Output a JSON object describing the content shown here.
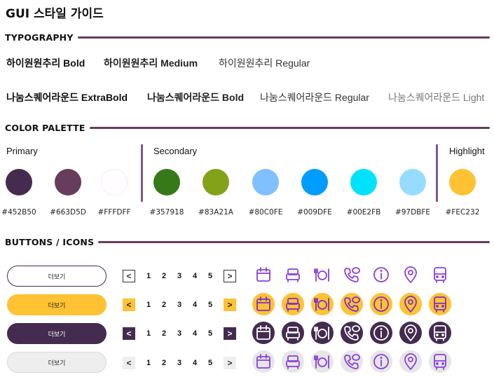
{
  "title": "GUI 스타일 가이드",
  "sections": {
    "typography": "TYPOGRAPHY",
    "color": "COLOR PALETTE",
    "buttons": "BUTTONS / ICONS"
  },
  "typography": {
    "row1": [
      "하이원원추리 Bold",
      "하이원원추리 Medium",
      "하이원원추리 Regular"
    ],
    "row2": [
      "나눔스퀘어라운드 ExtraBold",
      "나눔스퀘어라운드 Bold",
      "나눔스퀘어라운드 Regular",
      "나눔스퀘어라운드 Light"
    ]
  },
  "palette": {
    "primary_label": "Primary",
    "secondary_label": "Secondary",
    "highlight_label": "Highlight",
    "primary": [
      {
        "hex": "#452B50",
        "color": "#452B50"
      },
      {
        "hex": "#663D5D",
        "color": "#663D5D"
      },
      {
        "hex": "#FFFDFF",
        "color": "#FFFDFF"
      }
    ],
    "secondary": [
      {
        "hex": "#357918",
        "color": "#357918"
      },
      {
        "hex": "#83A21A",
        "color": "#83A21A"
      },
      {
        "hex": "#80C0FE",
        "color": "#80C0FE"
      },
      {
        "hex": "#009DFE",
        "color": "#009DFE"
      },
      {
        "hex": "#00E2FB",
        "color": "#00E2FB"
      },
      {
        "hex": "#97DBFE",
        "color": "#97DBFE"
      }
    ],
    "highlight": [
      {
        "hex": "#FEC232",
        "color": "#FEC232"
      }
    ]
  },
  "buttons": [
    {
      "label": "더보기"
    },
    {
      "label": "더보기"
    },
    {
      "label": "더보기"
    },
    {
      "label": "더보기"
    }
  ],
  "pager": {
    "prev": "<",
    "next": ">",
    "pages": [
      "1",
      "2",
      "3",
      "4",
      "5"
    ]
  },
  "icon_names": [
    "calendar-icon",
    "bed-icon",
    "restaurant-icon",
    "phone-chat-icon",
    "info-icon",
    "location-pin-icon",
    "bus-icon"
  ],
  "colors": {
    "accent": "#663D5D",
    "primary_dark": "#452B50",
    "highlight": "#FEC232",
    "icon_purple": "#7B3FE4"
  }
}
